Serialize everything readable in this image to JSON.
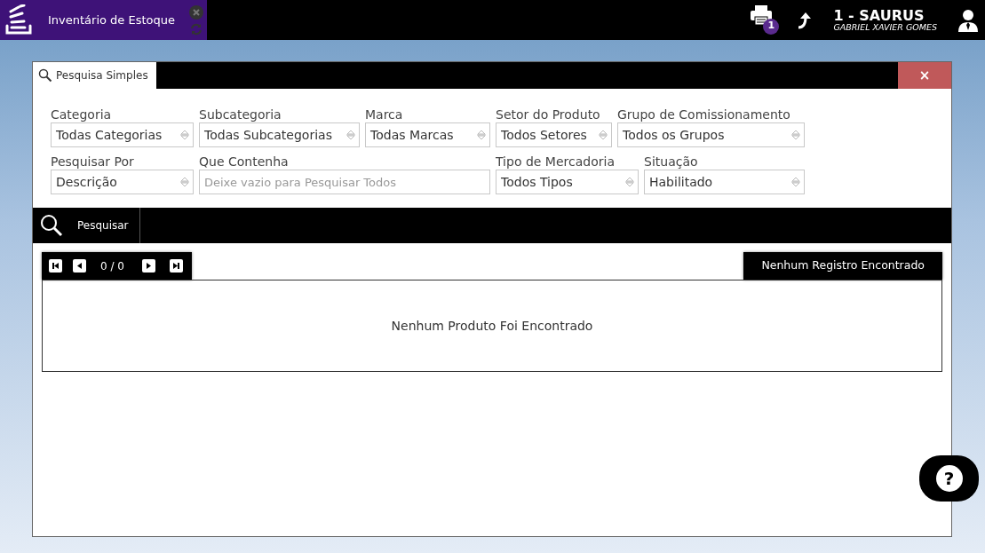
{
  "header": {
    "app_title": "Inventário de Estoque",
    "print_badge": "1",
    "company": "1 - SAURUS",
    "user": "GABRIEL XAVIER GOMES"
  },
  "dialog": {
    "tab": "Pesquisa Simples",
    "close": "×"
  },
  "filter_rows": [
    [
      {
        "kind": "select",
        "label": "Categoria",
        "value": "Todas Categorias"
      },
      {
        "kind": "select",
        "label": "Subcategoria",
        "value": "Todas Subcategorias"
      },
      {
        "kind": "select",
        "label": "Marca",
        "value": "Todas Marcas"
      },
      {
        "kind": "select",
        "label": "Setor do Produto",
        "value": "Todos Setores"
      },
      {
        "kind": "select",
        "label": "Grupo de Comissionamento",
        "value": "Todos os Grupos"
      }
    ],
    [
      {
        "kind": "select",
        "label": "Pesquisar Por",
        "value": "Descrição"
      },
      {
        "kind": "text",
        "label": "Que Contenha",
        "placeholder": "Deixe vazio para Pesquisar Todos"
      },
      {
        "kind": "select",
        "label": "Tipo de Mercadoria",
        "value": "Todos Tipos"
      },
      {
        "kind": "select",
        "label": "Situação",
        "value": "Habilitado"
      }
    ]
  ],
  "search_button": "Pesquisar",
  "pager": {
    "counter": "0 / 0"
  },
  "records_status": "Nenhum Registro Encontrado",
  "results_message": "Nenhum Produto Foi Encontrado",
  "help_button": "?"
}
